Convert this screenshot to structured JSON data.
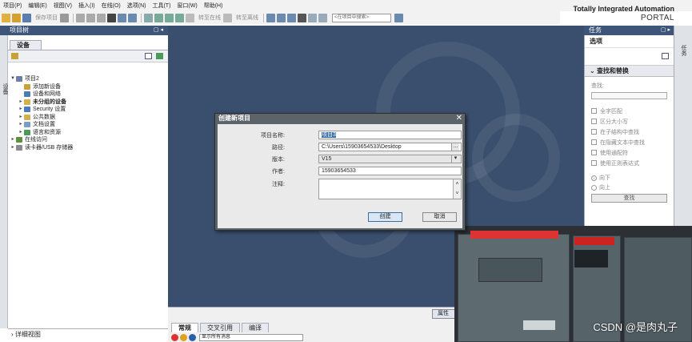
{
  "menu": [
    "项目(P)",
    "编辑(E)",
    "视图(V)",
    "插入(I)",
    "在线(O)",
    "选项(N)",
    "工具(T)",
    "窗口(W)",
    "帮助(H)"
  ],
  "brand": {
    "line1": "Totally Integrated Automation",
    "line2": "PORTAL"
  },
  "toolbar": {
    "save_project": "保存项目",
    "go_online": "转至在线",
    "go_offline": "转至离线",
    "search_placeholder": "<在项目中搜索>"
  },
  "left": {
    "header": "项目树",
    "strip_label": "设备",
    "devices_tab": "设备",
    "tree": [
      {
        "label": "项目2",
        "level": 0,
        "twisty": "▼",
        "icon": "project-icon",
        "color": "#6a7fa8"
      },
      {
        "label": "添加新设备",
        "level": 1,
        "twisty": "",
        "icon": "add-device-icon",
        "color": "#c9a13b"
      },
      {
        "label": "设备和网络",
        "level": 1,
        "twisty": "",
        "icon": "network-icon",
        "color": "#4a7db5"
      },
      {
        "label": "未分组的设备",
        "level": 1,
        "twisty": "▸",
        "icon": "folder-icon",
        "color": "#d4b04a",
        "bold": true
      },
      {
        "label": "Security 设置",
        "level": 1,
        "twisty": "▸",
        "icon": "security-icon",
        "color": "#4a7db5"
      },
      {
        "label": "公共数据",
        "level": 1,
        "twisty": "▸",
        "icon": "common-data-icon",
        "color": "#d4b04a"
      },
      {
        "label": "文档设置",
        "level": 1,
        "twisty": "▸",
        "icon": "document-icon",
        "color": "#7a9cc6"
      },
      {
        "label": "语言和资源",
        "level": 1,
        "twisty": "▸",
        "icon": "language-icon",
        "color": "#4a9a5a"
      },
      {
        "label": "在线访问",
        "level": 0,
        "twisty": "▸",
        "icon": "online-access-icon",
        "color": "#5c8f3f"
      },
      {
        "label": "读卡器/USB 存储器",
        "level": 0,
        "twisty": "▸",
        "icon": "card-reader-icon",
        "color": "#8a8a8a"
      }
    ],
    "detail_view": "详细视图"
  },
  "bottom": {
    "tabs": [
      "常规",
      "交叉引用",
      "编译"
    ],
    "inspect_tab": "属性",
    "filter": "显示所有消息"
  },
  "right": {
    "header": "任务",
    "strip_label": "任务",
    "options": "选项",
    "find_replace": "查找和替换",
    "find_label": "查找:",
    "checks": [
      "全字匹配",
      "区分大小写",
      "在子结构中查找",
      "在隐藏文本中查找",
      "使用通配符",
      "使用正则表达式"
    ],
    "radios": [
      "向下",
      "向上"
    ],
    "find_button": "查找"
  },
  "dialog": {
    "title": "创建新项目",
    "fields": [
      {
        "label": "项目名称:",
        "value": "项目3",
        "selected": true
      },
      {
        "label": "路径:",
        "value": "C:\\Users\\15903654533\\Desktop",
        "button": "..."
      },
      {
        "label": "版本:",
        "value": "V15",
        "button": "▾"
      },
      {
        "label": "作者:",
        "value": "15903654533"
      },
      {
        "label": "注释:",
        "value": ""
      }
    ],
    "create": "创建",
    "cancel": "取消"
  },
  "watermark": "CSDN @是肉丸子"
}
